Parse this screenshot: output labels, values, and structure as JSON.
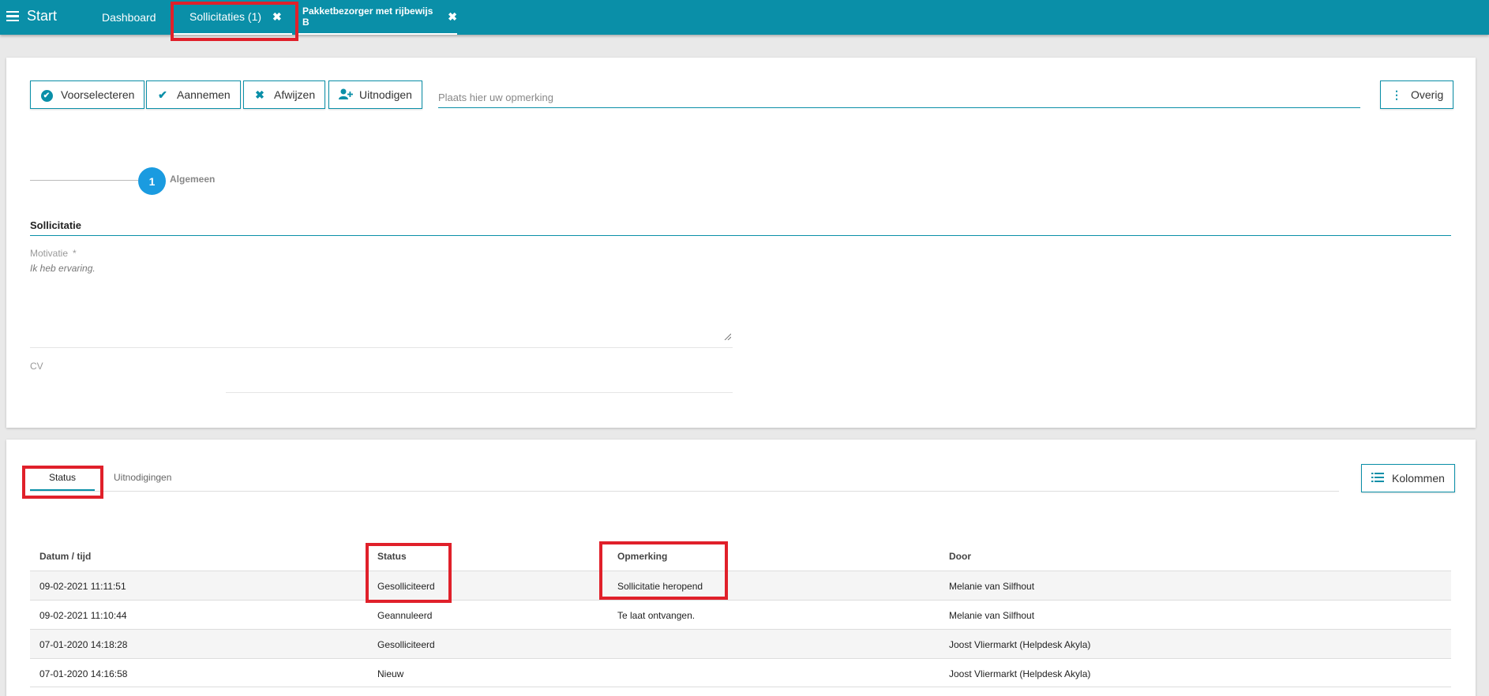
{
  "topbar": {
    "start_label": "Start",
    "tabs": [
      {
        "label": "Dashboard"
      },
      {
        "label": "Sollicitaties (1)",
        "close": "✖"
      },
      {
        "label": "Pakketbezorger met rijbewijs B",
        "close": "✖"
      }
    ]
  },
  "actions": {
    "buttons": [
      {
        "label": "Voorselecteren",
        "icon": "check-circle-icon"
      },
      {
        "label": "Aannemen",
        "icon": "check-icon"
      },
      {
        "label": "Afwijzen",
        "icon": "close-icon"
      },
      {
        "label": "Uitnodigen",
        "icon": "user-plus-icon"
      }
    ],
    "remark_placeholder": "Plaats hier uw opmerking",
    "overig_label": "Overig"
  },
  "stepper": {
    "number": "1",
    "label": "Algemeen"
  },
  "form": {
    "section_title": "Sollicitatie",
    "motivatie_label": "Motivatie",
    "required_marker": "*",
    "motivatie_value": "Ik heb ervaring.",
    "cv_label": "CV"
  },
  "history": {
    "tabs": [
      {
        "label": "Status"
      },
      {
        "label": "Uitnodigingen"
      }
    ],
    "kolommen_label": "Kolommen",
    "columns": [
      "Datum / tijd",
      "Status",
      "Opmerking",
      "Door"
    ],
    "rows": [
      {
        "datum": "09-02-2021 11:11:51",
        "status": "Gesolliciteerd",
        "opmerking": "Sollicitatie heropend",
        "door": "Melanie van Silfhout"
      },
      {
        "datum": "09-02-2021 11:10:44",
        "status": "Geannuleerd",
        "opmerking": "Te laat ontvangen.",
        "door": "Melanie van Silfhout"
      },
      {
        "datum": "07-01-2020 14:18:28",
        "status": "Gesolliciteerd",
        "opmerking": "",
        "door": "Joost Vliermarkt (Helpdesk Akyla)"
      },
      {
        "datum": "07-01-2020 14:16:58",
        "status": "Nieuw",
        "opmerking": "",
        "door": "Joost Vliermarkt (Helpdesk Akyla)"
      }
    ]
  },
  "colors": {
    "accent": "#0a8fa8",
    "step": "#1a9be0",
    "highlight": "#e0202a"
  }
}
